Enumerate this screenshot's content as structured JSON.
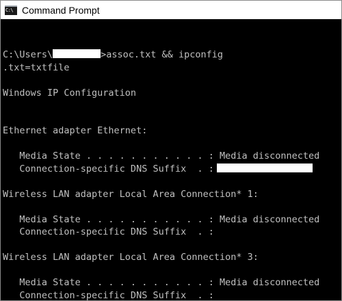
{
  "window": {
    "title": "Command Prompt",
    "icon": "C:\\"
  },
  "console": {
    "lines": [
      "",
      "",
      "C:\\Users\\",
      ".txt=txtfile",
      "",
      "Windows IP Configuration",
      "",
      "",
      "Ethernet adapter Ethernet:",
      "",
      "   Media State . . . . . . . . . . . : Media disconnected",
      "   Connection-specific DNS Suffix  . :",
      "",
      "Wireless LAN adapter Local Area Connection* 1:",
      "",
      "   Media State . . . . . . . . . . . : Media disconnected",
      "   Connection-specific DNS Suffix  . :",
      "",
      "Wireless LAN adapter Local Area Connection* 3:",
      "",
      "   Media State . . . . . . . . . . . : Media disconnected",
      "   Connection-specific DNS Suffix  . :"
    ],
    "command": ">assoc.txt && ipconfig"
  }
}
